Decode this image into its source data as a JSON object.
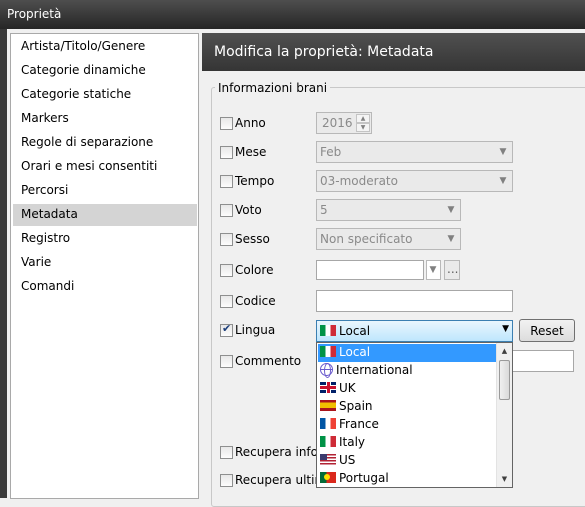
{
  "window": {
    "title": "Proprietà"
  },
  "sidebar": {
    "items": [
      {
        "label": "Artista/Titolo/Genere"
      },
      {
        "label": "Categorie dinamiche"
      },
      {
        "label": "Categorie statiche"
      },
      {
        "label": "Markers"
      },
      {
        "label": "Regole di separazione"
      },
      {
        "label": "Orari e mesi consentiti"
      },
      {
        "label": "Percorsi"
      },
      {
        "label": "Metadata",
        "selected": true
      },
      {
        "label": "Registro"
      },
      {
        "label": "Varie"
      },
      {
        "label": "Comandi"
      }
    ]
  },
  "header": {
    "title": "Modifica la proprietà: Metadata"
  },
  "group": {
    "title": "Informazioni brani"
  },
  "fields": {
    "anno": {
      "label": "Anno",
      "value": "2016",
      "checked": false
    },
    "mese": {
      "label": "Mese",
      "value": "Feb",
      "checked": false
    },
    "tempo": {
      "label": "Tempo",
      "value": "03-moderato",
      "checked": false
    },
    "voto": {
      "label": "Voto",
      "value": "5",
      "checked": false
    },
    "sesso": {
      "label": "Sesso",
      "value": "Non specificato",
      "checked": false
    },
    "colore": {
      "label": "Colore",
      "value": "",
      "browse": "...",
      "checked": false
    },
    "codice": {
      "label": "Codice",
      "value": "",
      "checked": false
    },
    "lingua": {
      "label": "Lingua",
      "value": "Local",
      "checked": true,
      "reset_label": "Reset"
    },
    "commento": {
      "label": "Commento",
      "value": "",
      "checked": false
    },
    "recupera_info": {
      "label": "Recupera infor",
      "checked": false
    },
    "recupera_ultimo": {
      "label": "Recupera ultim",
      "checked": false
    }
  },
  "language_dropdown": {
    "options": [
      {
        "label": "Local",
        "icon": "italy-flag-icon",
        "selected": true
      },
      {
        "label": "International",
        "icon": "globe-icon"
      },
      {
        "label": "UK",
        "icon": "uk-flag-icon"
      },
      {
        "label": "Spain",
        "icon": "spain-flag-icon"
      },
      {
        "label": "France",
        "icon": "france-flag-icon"
      },
      {
        "label": "Italy",
        "icon": "italy-flag-icon"
      },
      {
        "label": "US",
        "icon": "us-flag-icon"
      },
      {
        "label": "Portugal",
        "icon": "portugal-flag-icon"
      }
    ]
  },
  "colors": {
    "selection": "#3399ff",
    "header_bg": "#404040",
    "sidebar_selected": "#d4d4d4"
  }
}
